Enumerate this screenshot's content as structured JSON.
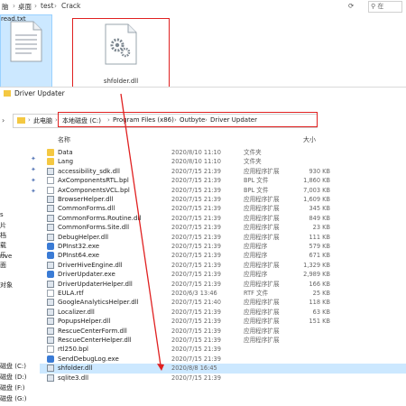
{
  "top_window": {
    "breadcrumb": [
      "脑",
      "桌面",
      "test",
      "Crack"
    ],
    "search_placeholder": "在",
    "files": [
      {
        "name": "read.txt",
        "icon": "text-file-icon"
      },
      {
        "name": "shfolder.dll",
        "icon": "gear-file-icon"
      }
    ]
  },
  "second_window": {
    "title": "Driver Updater",
    "address": [
      "此电脑",
      "本地磁盘 (C:)",
      "Program Files (x86)",
      "Outbyte",
      "Driver Updater"
    ],
    "columns": {
      "name": "名称",
      "size": "大小"
    },
    "nav": [
      "s",
      "片",
      "档",
      "载",
      "乐",
      "面",
      "rive",
      "对象",
      "磁盘 (C:)",
      "磁盘 (D:)",
      "磁盘 (F:)",
      "磁盘 (G:)"
    ],
    "files": [
      {
        "name": "Data",
        "date": "2020/8/10 11:10",
        "type": "文件夹",
        "size": "",
        "icon": "folder"
      },
      {
        "name": "Lang",
        "date": "2020/8/10 11:10",
        "type": "文件夹",
        "size": "",
        "icon": "folder"
      },
      {
        "name": "accessibility_sdk.dll",
        "date": "2020/7/15 21:39",
        "type": "应用程序扩展",
        "size": "930 KB",
        "icon": "app"
      },
      {
        "name": "AxComponentsRTL.bpl",
        "date": "2020/7/15 21:39",
        "type": "BPL 文件",
        "size": "1,860 KB",
        "icon": "file"
      },
      {
        "name": "AxComponentsVCL.bpl",
        "date": "2020/7/15 21:39",
        "type": "BPL 文件",
        "size": "7,003 KB",
        "icon": "file"
      },
      {
        "name": "BrowserHelper.dll",
        "date": "2020/7/15 21:39",
        "type": "应用程序扩展",
        "size": "1,609 KB",
        "icon": "app"
      },
      {
        "name": "CommonForms.dll",
        "date": "2020/7/15 21:39",
        "type": "应用程序扩展",
        "size": "345 KB",
        "icon": "app"
      },
      {
        "name": "CommonForms.Routine.dll",
        "date": "2020/7/15 21:39",
        "type": "应用程序扩展",
        "size": "849 KB",
        "icon": "app"
      },
      {
        "name": "CommonForms.Site.dll",
        "date": "2020/7/15 21:39",
        "type": "应用程序扩展",
        "size": "23 KB",
        "icon": "app"
      },
      {
        "name": "DebugHelper.dll",
        "date": "2020/7/15 21:39",
        "type": "应用程序扩展",
        "size": "111 KB",
        "icon": "app"
      },
      {
        "name": "DPInst32.exe",
        "date": "2020/7/15 21:39",
        "type": "应用程序",
        "size": "579 KB",
        "icon": "exe"
      },
      {
        "name": "DPInst64.exe",
        "date": "2020/7/15 21:39",
        "type": "应用程序",
        "size": "671 KB",
        "icon": "exe"
      },
      {
        "name": "DriverHiveEngine.dll",
        "date": "2020/7/15 21:39",
        "type": "应用程序扩展",
        "size": "1,329 KB",
        "icon": "app"
      },
      {
        "name": "DriverUpdater.exe",
        "date": "2020/7/15 21:39",
        "type": "应用程序",
        "size": "2,989 KB",
        "icon": "exe"
      },
      {
        "name": "DriverUpdaterHelper.dll",
        "date": "2020/7/15 21:39",
        "type": "应用程序扩展",
        "size": "166 KB",
        "icon": "app"
      },
      {
        "name": "EULA.rtf",
        "date": "2020/6/3 13:46",
        "type": "RTF 文件",
        "size": "25 KB",
        "icon": "file"
      },
      {
        "name": "GoogleAnalyticsHelper.dll",
        "date": "2020/7/15 21:40",
        "type": "应用程序扩展",
        "size": "118 KB",
        "icon": "app"
      },
      {
        "name": "Localizer.dll",
        "date": "2020/7/15 21:39",
        "type": "应用程序扩展",
        "size": "63 KB",
        "icon": "app"
      },
      {
        "name": "PopupsHelper.dll",
        "date": "2020/7/15 21:39",
        "type": "应用程序扩展",
        "size": "151 KB",
        "icon": "app"
      },
      {
        "name": "RescueCenterForm.dll",
        "date": "2020/7/15 21:39",
        "type": "应用程序扩展",
        "size": "",
        "icon": "app"
      },
      {
        "name": "RescueCenterHelper.dll",
        "date": "2020/7/15 21:39",
        "type": "应用程序扩展",
        "size": "",
        "icon": "app"
      },
      {
        "name": "rtl250.bpl",
        "date": "2020/7/15 21:39",
        "type": "",
        "size": "",
        "icon": "file"
      },
      {
        "name": "SendDebugLog.exe",
        "date": "2020/7/15 21:39",
        "type": "",
        "size": "",
        "icon": "exe"
      },
      {
        "name": "shfolder.dll",
        "date": "2020/8/8 16:45",
        "type": "",
        "size": "",
        "icon": "app",
        "selected": true
      },
      {
        "name": "sqlite3.dll",
        "date": "2020/7/15 21:39",
        "type": "",
        "size": "",
        "icon": "app"
      }
    ]
  },
  "colors": {
    "selection": "#cce8ff",
    "highlight_box": "#e02020",
    "folder": "#f4c842"
  }
}
